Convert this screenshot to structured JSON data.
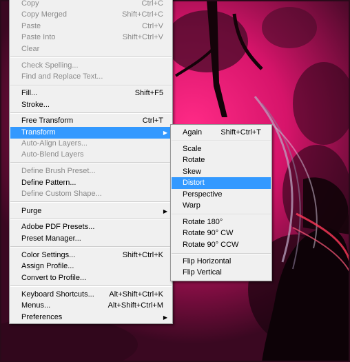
{
  "edit_menu": {
    "items": [
      {
        "label": "Copy",
        "shortcut": "Ctrl+C",
        "disabled": true
      },
      {
        "label": "Copy Merged",
        "shortcut": "Shift+Ctrl+C",
        "disabled": true
      },
      {
        "label": "Paste",
        "shortcut": "Ctrl+V",
        "disabled": true
      },
      {
        "label": "Paste Into",
        "shortcut": "Shift+Ctrl+V",
        "disabled": true
      },
      {
        "label": "Clear",
        "shortcut": "",
        "disabled": true
      },
      {
        "label": "Check Spelling...",
        "shortcut": "",
        "disabled": true
      },
      {
        "label": "Find and Replace Text...",
        "shortcut": "",
        "disabled": true
      },
      {
        "label": "Fill...",
        "shortcut": "Shift+F5",
        "disabled": false
      },
      {
        "label": "Stroke...",
        "shortcut": "",
        "disabled": false
      },
      {
        "label": "Free Transform",
        "shortcut": "Ctrl+T",
        "disabled": false
      },
      {
        "label": "Transform",
        "shortcut": "",
        "disabled": false,
        "selected": true,
        "submenu": true
      },
      {
        "label": "Auto-Align Layers...",
        "shortcut": "",
        "disabled": true
      },
      {
        "label": "Auto-Blend Layers",
        "shortcut": "",
        "disabled": true
      },
      {
        "label": "Define Brush Preset...",
        "shortcut": "",
        "disabled": true
      },
      {
        "label": "Define Pattern...",
        "shortcut": "",
        "disabled": false
      },
      {
        "label": "Define Custom Shape...",
        "shortcut": "",
        "disabled": true
      },
      {
        "label": "Purge",
        "shortcut": "",
        "disabled": false,
        "submenu": true
      },
      {
        "label": "Adobe PDF Presets...",
        "shortcut": "",
        "disabled": false
      },
      {
        "label": "Preset Manager...",
        "shortcut": "",
        "disabled": false
      },
      {
        "label": "Color Settings...",
        "shortcut": "Shift+Ctrl+K",
        "disabled": false
      },
      {
        "label": "Assign Profile...",
        "shortcut": "",
        "disabled": false
      },
      {
        "label": "Convert to Profile...",
        "shortcut": "",
        "disabled": false
      },
      {
        "label": "Keyboard Shortcuts...",
        "shortcut": "Alt+Shift+Ctrl+K",
        "disabled": false
      },
      {
        "label": "Menus...",
        "shortcut": "Alt+Shift+Ctrl+M",
        "disabled": false
      },
      {
        "label": "Preferences",
        "shortcut": "",
        "disabled": false,
        "submenu": true
      }
    ]
  },
  "transform_menu": {
    "items": [
      {
        "label": "Again",
        "shortcut": "Shift+Ctrl+T"
      },
      {
        "label": "Scale",
        "shortcut": ""
      },
      {
        "label": "Rotate",
        "shortcut": ""
      },
      {
        "label": "Skew",
        "shortcut": ""
      },
      {
        "label": "Distort",
        "shortcut": "",
        "selected": true
      },
      {
        "label": "Perspective",
        "shortcut": ""
      },
      {
        "label": "Warp",
        "shortcut": ""
      },
      {
        "label": "Rotate 180°",
        "shortcut": ""
      },
      {
        "label": "Rotate 90° CW",
        "shortcut": ""
      },
      {
        "label": "Rotate 90° CCW",
        "shortcut": ""
      },
      {
        "label": "Flip Horizontal",
        "shortcut": ""
      },
      {
        "label": "Flip Vertical",
        "shortcut": ""
      }
    ]
  },
  "icons": {
    "submenu_arrow": "chevron-right-icon"
  },
  "colors": {
    "highlight": "#3399ff",
    "canvas_pink": "#e0186f",
    "canvas_dark": "#1a0612"
  }
}
